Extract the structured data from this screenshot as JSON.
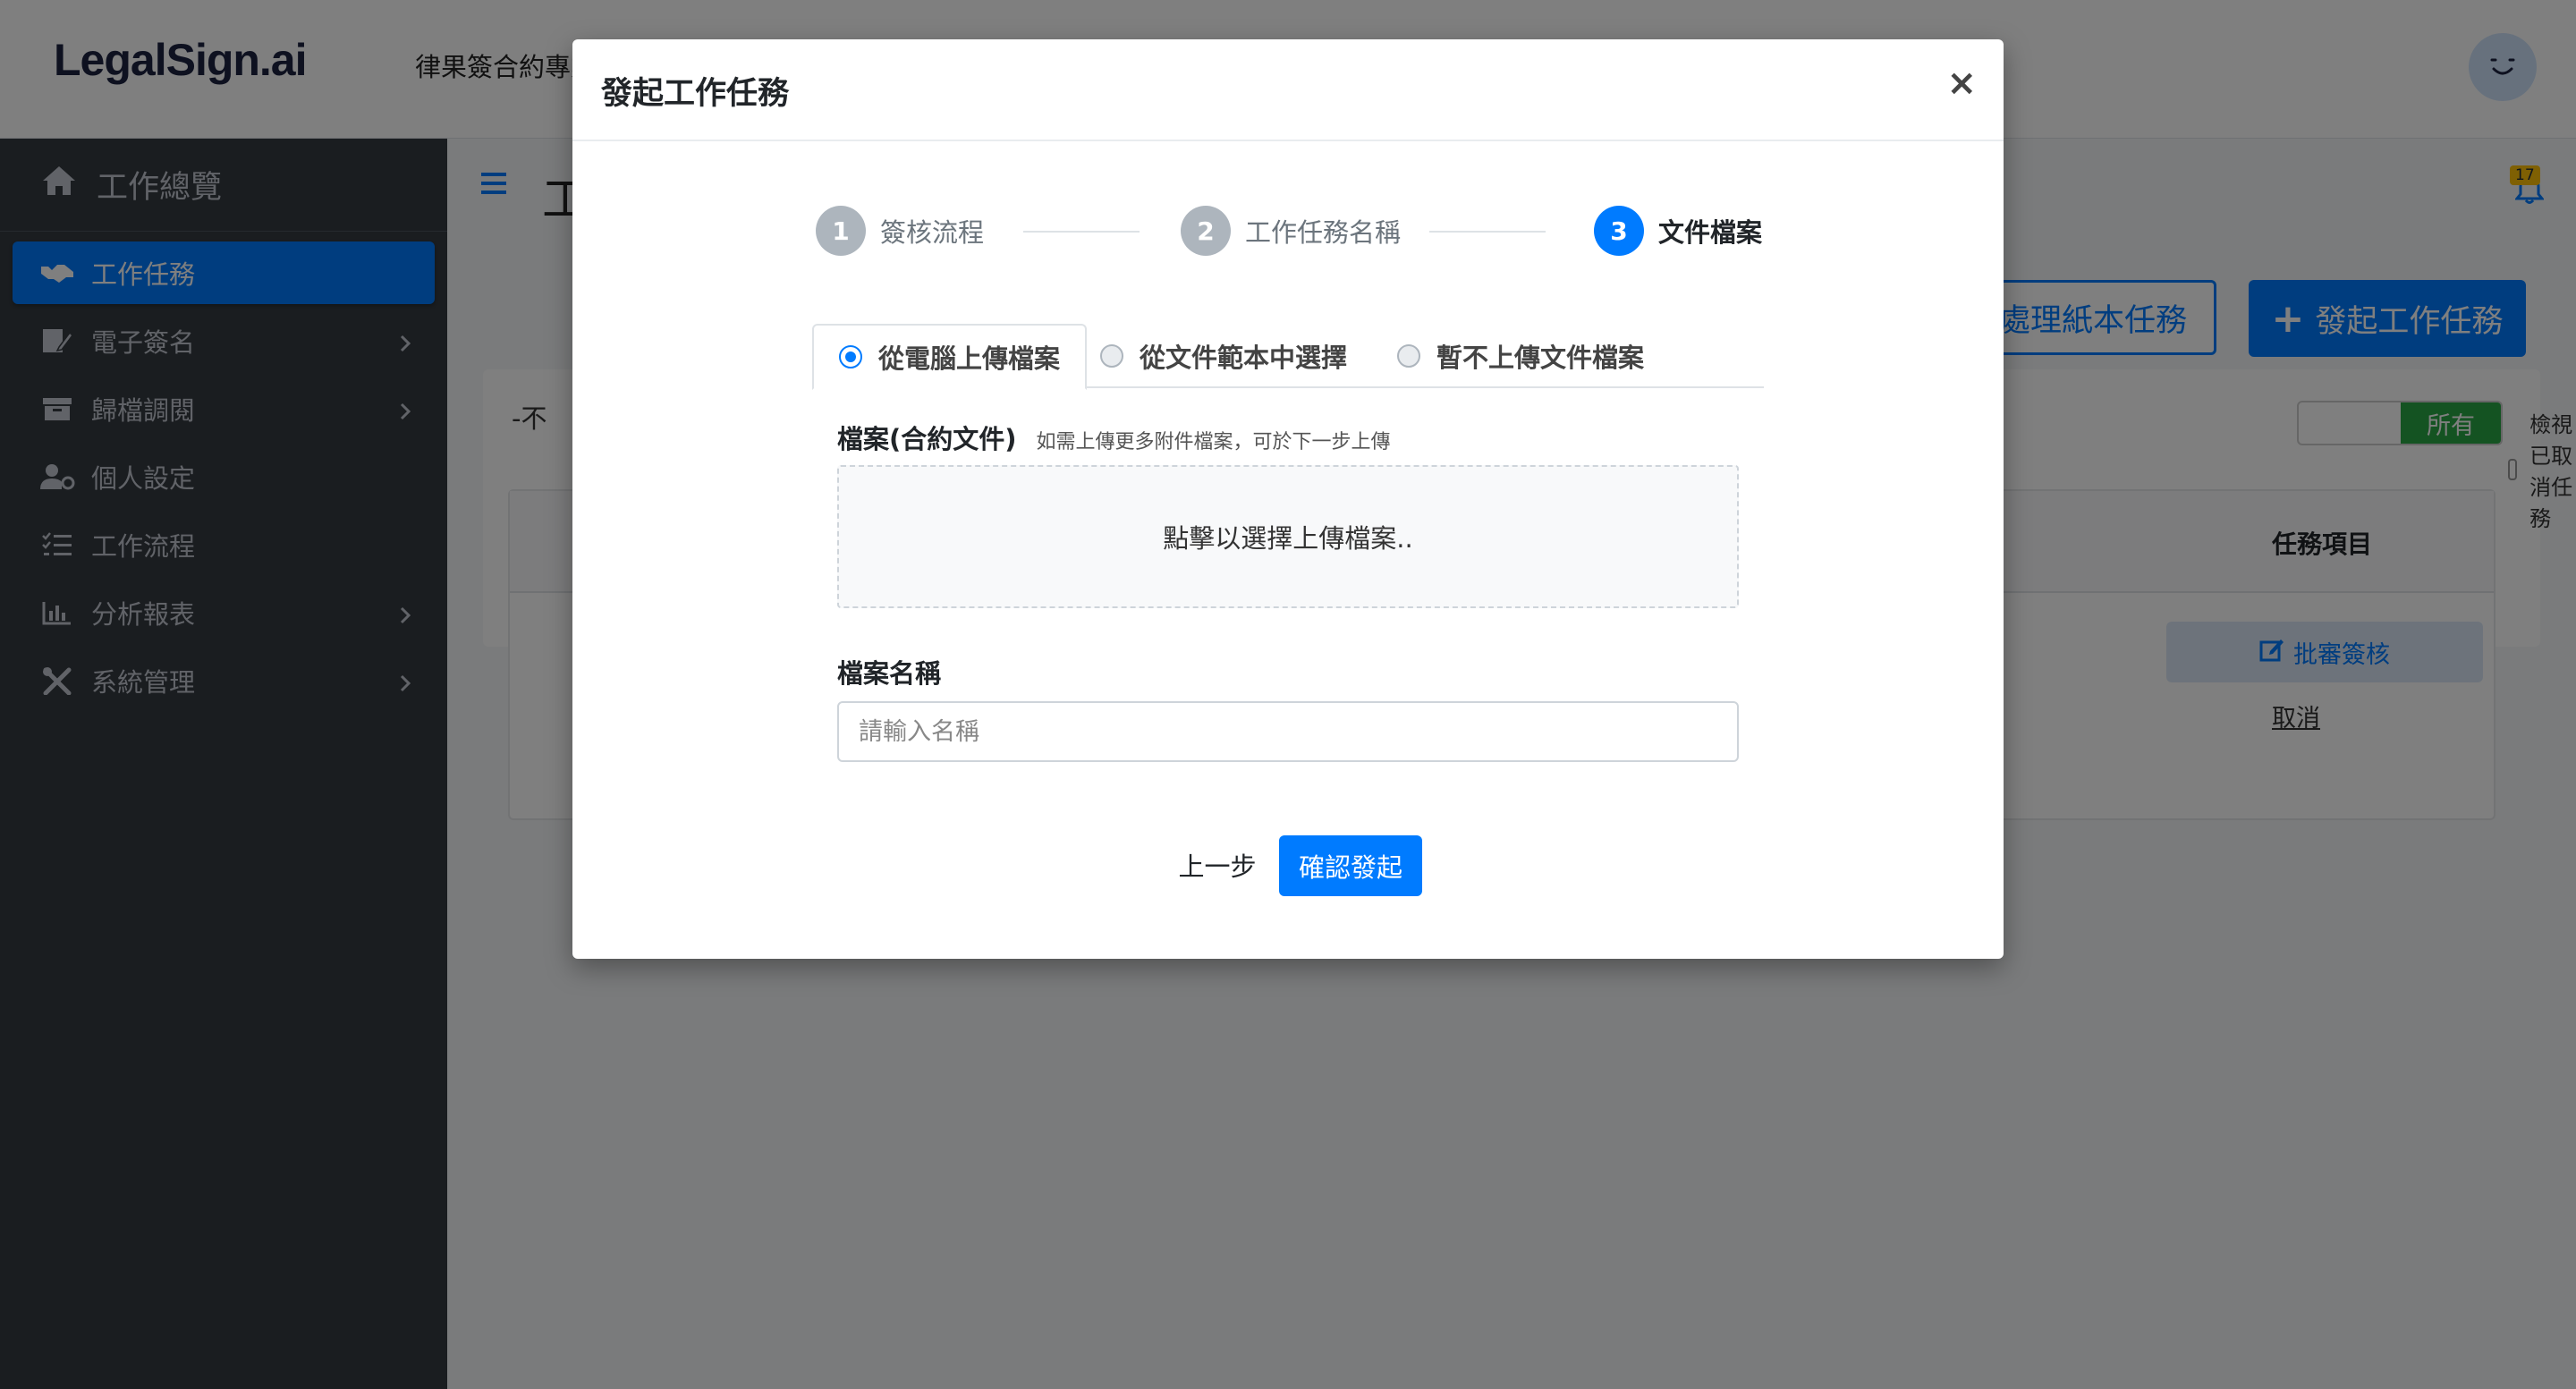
{
  "header": {
    "logo": "LegalSign.ai",
    "title": "律果簽合約專業版"
  },
  "sidebar": {
    "overview": "工作總覽",
    "items": [
      {
        "label": "工作任務",
        "icon": "handshake-icon",
        "active": true
      },
      {
        "label": "電子簽名",
        "icon": "signature-icon",
        "has_children": true
      },
      {
        "label": "歸檔調閱",
        "icon": "archive-icon",
        "has_children": true
      },
      {
        "label": "個人設定",
        "icon": "user-settings-icon"
      },
      {
        "label": "工作流程",
        "icon": "tasks-list-icon"
      },
      {
        "label": "分析報表",
        "icon": "bar-chart-icon",
        "has_children": true
      },
      {
        "label": "系統管理",
        "icon": "tools-icon",
        "has_children": true
      }
    ]
  },
  "content": {
    "page_title": "工",
    "notification_count": "17",
    "paper_task_button": "處理紙本任務",
    "new_task_button": "發起工作任務",
    "filter_text": "-不",
    "show_cancelled": "檢視已取消任務",
    "toggle_value": "所有",
    "table": {
      "col_task": "任務項目",
      "approve_button": "批審簽核",
      "cancel_link": "取消"
    }
  },
  "modal": {
    "title": "發起工作任務",
    "close": "×",
    "steps": [
      {
        "num": "1",
        "label": "簽核流程"
      },
      {
        "num": "2",
        "label": "工作任務名稱"
      },
      {
        "num": "3",
        "label": "文件檔案"
      }
    ],
    "active_step": 3,
    "source_tabs": [
      {
        "label": "從電腦上傳檔案",
        "selected": true
      },
      {
        "label": "從文件範本中選擇",
        "selected": false
      },
      {
        "label": "暫不上傳文件檔案",
        "selected": false
      }
    ],
    "file_label": "檔案(合約文件)",
    "file_hint": "如需上傳更多附件檔案，可於下一步上傳",
    "dropzone_text": "點擊以選擇上傳檔案..",
    "name_label": "檔案名稱",
    "name_placeholder": "請輸入名稱",
    "name_value": "",
    "prev_button": "上一步",
    "confirm_button": "確認發起"
  },
  "colors": {
    "primary": "#007bff",
    "sidebar_bg": "#343a40",
    "success": "#28a745",
    "badge": "#ffc107"
  }
}
